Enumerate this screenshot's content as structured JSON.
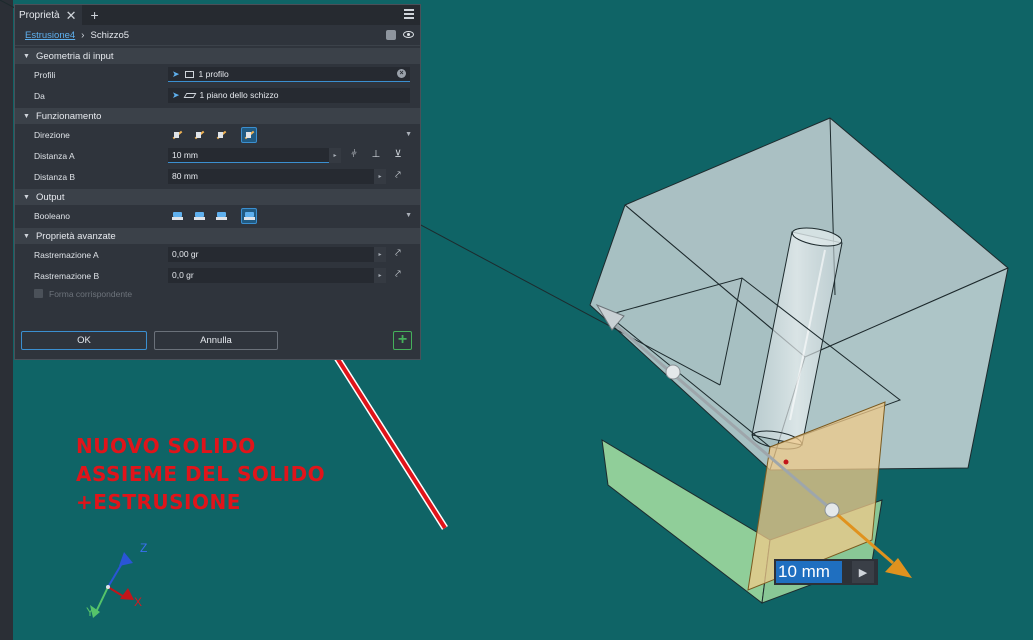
{
  "panel": {
    "tab_title": "Proprietà",
    "tab_close": "✕",
    "tab_add": "+",
    "breadcrumb": {
      "parent": "Estrusione4",
      "separator": "›",
      "current": "Schizzo5"
    },
    "sections": {
      "input_geometry": "Geometria di input",
      "behavior": "Funzionamento",
      "output": "Output",
      "advanced": "Proprietà avanzate"
    },
    "rows": {
      "profiles": {
        "label": "Profili",
        "value": "1 profilo"
      },
      "from": {
        "label": "Da",
        "value": "1 piano dello schizzo"
      },
      "direction": {
        "label": "Direzione"
      },
      "distance_a": {
        "label": "Distanza A",
        "value": "10 mm"
      },
      "distance_b": {
        "label": "Distanza B",
        "value": "80 mm"
      },
      "boolean": {
        "label": "Booleano"
      },
      "taper_a": {
        "label": "Rastremazione A",
        "value": "0,00 gr"
      },
      "taper_b": {
        "label": "Rastremazione B",
        "value": "0,0 gr"
      },
      "match_shape": {
        "label": "Forma corrispondente"
      }
    },
    "buttons": {
      "ok": "OK",
      "cancel": "Annulla",
      "add": "+"
    }
  },
  "annotation": {
    "line1": "NUOVO SOLIDO",
    "line2": "ASSIEME DEL SOLIDO",
    "line3": "+ESTRUSIONE"
  },
  "viewport": {
    "dimension_value": "10 mm",
    "dimension_play": "▶",
    "axis_labels": {
      "x": "X",
      "y": "Y",
      "z": "Z"
    }
  },
  "colors": {
    "viewport_bg": "#0f6466",
    "panel_bg": "#2f343c",
    "accent": "#3b8fd0",
    "annotation": "#e0141a",
    "arrow": "#e0141a",
    "orange_arrow": "#e0921e"
  },
  "icons": {
    "menu": "hamburger-icon",
    "visibility": "eye-icon",
    "selection": "cursor-icon",
    "profile": "sketch-profile-icon",
    "plane": "plane-icon",
    "clear": "clear-icon"
  }
}
